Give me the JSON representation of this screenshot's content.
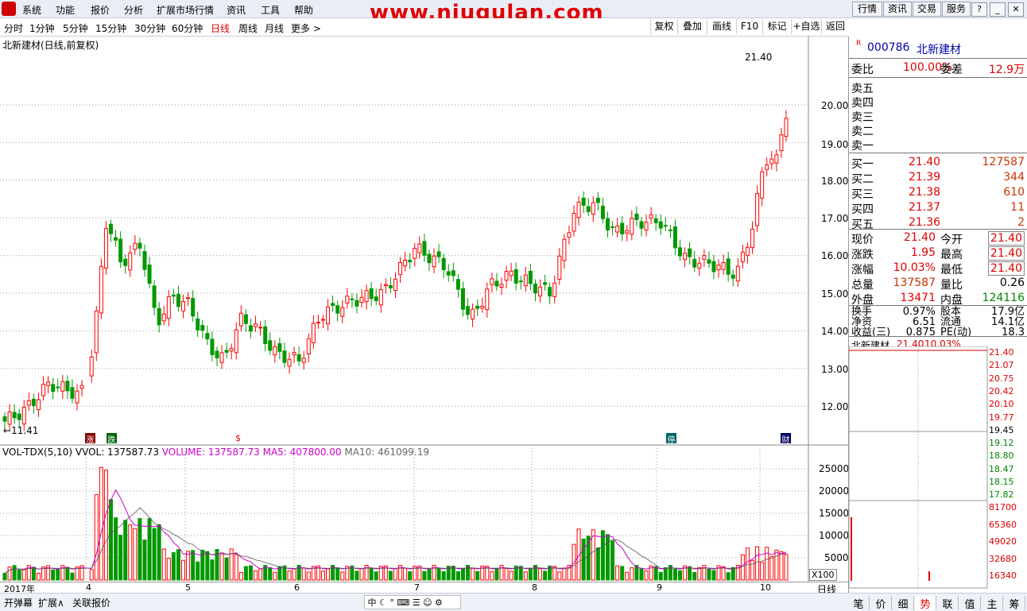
{
  "menu": {
    "items": [
      "系统",
      "功能",
      "报价",
      "分析",
      "扩展市场行情",
      "资讯",
      "工具",
      "帮助"
    ],
    "site_title": "www.niugulan.com",
    "right_buttons": [
      "行情",
      "资讯",
      "交易",
      "服务"
    ]
  },
  "toolbar": {
    "periods": [
      "分时",
      "1分钟",
      "5分钟",
      "15分钟",
      "30分钟",
      "60分钟",
      "日线",
      "周线",
      "月线",
      "更多 >"
    ],
    "active_period": "日线",
    "buttons": [
      "复权",
      "叠加",
      "画线",
      "F10",
      "标记",
      "+自选",
      "返回"
    ]
  },
  "chart": {
    "title": "北新建材(日线,前复权)",
    "price_ticks": [
      "20.00",
      "19.00",
      "18.00",
      "17.00",
      "16.00",
      "15.00",
      "14.00",
      "13.00",
      "12.00"
    ],
    "high_label": "21.40",
    "low_label": "11.41",
    "vol_title": "VOL-TDX(5,10)",
    "vol_label": "VVOL: 137587.73",
    "volume_label": "VOLUME: 137587.73",
    "ma5_label": "MA5: 407800.00",
    "ma10_label": "MA10: 461099.19",
    "vol_ticks": [
      "25000",
      "20000",
      "15000",
      "10000",
      "5000"
    ],
    "vol_unit": "X100",
    "month_labels": [
      "2017年",
      "4",
      "5",
      "6",
      "7",
      "8",
      "9",
      "10"
    ],
    "period_label": "日线",
    "event_markers": [
      "涨",
      "跌",
      "$",
      "停",
      "财"
    ],
    "colors": {
      "up": "#ff0000",
      "down": "#009900",
      "ma5": "#cc00cc",
      "ma10": "#555555"
    }
  },
  "stock": {
    "code": "000786",
    "name": "北新建材",
    "wei_bi_label": "委比",
    "wei_bi": "100.00%",
    "wei_cha_label": "委差",
    "wei_cha": "12.9万",
    "sell": [
      {
        "label": "卖五",
        "price": "",
        "vol": ""
      },
      {
        "label": "卖四",
        "price": "",
        "vol": ""
      },
      {
        "label": "卖三",
        "price": "",
        "vol": ""
      },
      {
        "label": "卖二",
        "price": "",
        "vol": ""
      },
      {
        "label": "卖一",
        "price": "",
        "vol": ""
      }
    ],
    "buy": [
      {
        "label": "买一",
        "price": "21.40",
        "vol": "127587"
      },
      {
        "label": "买二",
        "price": "21.39",
        "vol": "344"
      },
      {
        "label": "买三",
        "price": "21.38",
        "vol": "610"
      },
      {
        "label": "买四",
        "price": "21.37",
        "vol": "11"
      },
      {
        "label": "买五",
        "price": "21.36",
        "vol": "2"
      }
    ],
    "quote": [
      {
        "l1": "现价",
        "v1": "21.40",
        "l2": "今开",
        "v2": "21.40"
      },
      {
        "l1": "涨跌",
        "v1": "1.95",
        "l2": "最高",
        "v2": "21.40"
      },
      {
        "l1": "涨幅",
        "v1": "10.03%",
        "l2": "最低",
        "v2": "21.40"
      },
      {
        "l1": "总量",
        "v1": "137587",
        "l2": "量比",
        "v2": "0.26"
      },
      {
        "l1": "外盘",
        "v1": "13471",
        "l2": "内盘",
        "v2": "124116"
      }
    ],
    "stats": [
      {
        "l1": "换手",
        "v1": "0.97%",
        "l2": "股本",
        "v2": "17.9亿"
      },
      {
        "l1": "净资",
        "v1": "6.51",
        "l2": "流通",
        "v2": "14.1亿"
      },
      {
        "l1": "收益(三)",
        "v1": "0.875",
        "l2": "PE(动)",
        "v2": "18.3"
      }
    ],
    "mini_title": "北新建材",
    "mini_price": "21.40",
    "mini_pct": "10.03%",
    "mini_price_ticks": [
      "21.40",
      "21.07",
      "20.75",
      "20.42",
      "20.10",
      "19.77",
      "19.45",
      "19.12",
      "18.80",
      "18.47",
      "18.15",
      "17.82"
    ],
    "mini_vol_ticks": [
      "81700",
      "65360",
      "49020",
      "32680",
      "16340"
    ]
  },
  "bottom": {
    "left_buttons": [
      "开弹幕",
      "扩展∧",
      "关联报价"
    ],
    "tabs": [
      "笔",
      "价",
      "细",
      "势",
      "联",
      "值",
      "主",
      "筹"
    ],
    "active_tab": "势"
  }
}
